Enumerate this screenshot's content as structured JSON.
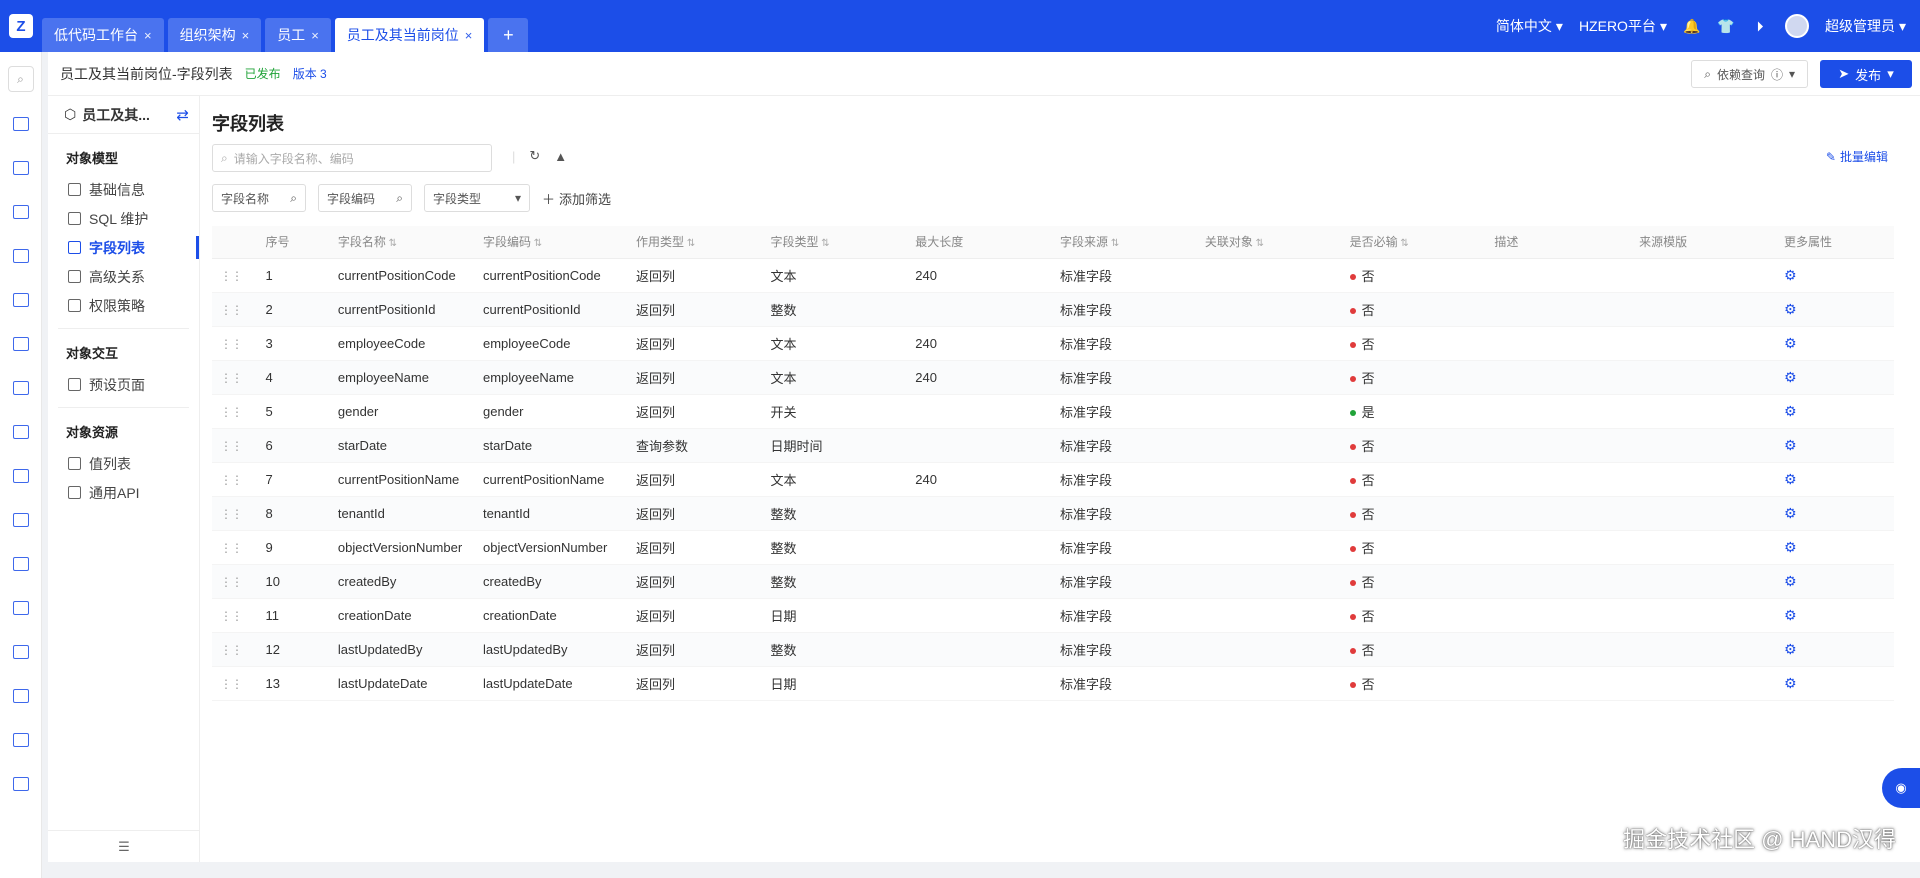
{
  "tabs": [
    {
      "label": "低代码工作台",
      "active": false
    },
    {
      "label": "组织架构",
      "active": false
    },
    {
      "label": "员工",
      "active": false
    },
    {
      "label": "员工及其当前岗位",
      "active": true
    }
  ],
  "topbar": {
    "language": "简体中文",
    "platform": "HZERO平台",
    "user": "超级管理员"
  },
  "header": {
    "title": "员工及其当前岗位-字段列表",
    "status": "已发布",
    "version": "版本 3",
    "dependency_btn": "依赖查询",
    "publish_btn": "发布"
  },
  "nav": {
    "title": "员工及其...",
    "sections": [
      {
        "title": "对象模型",
        "items": [
          "基础信息",
          "SQL 维护",
          "字段列表",
          "高级关系",
          "权限策略"
        ]
      },
      {
        "title": "对象交互",
        "items": [
          "预设页面"
        ]
      },
      {
        "title": "对象资源",
        "items": [
          "值列表",
          "通用API"
        ]
      }
    ]
  },
  "main": {
    "title": "字段列表",
    "search_placeholder": "请输入字段名称、编码",
    "batch_edit": "批量编辑",
    "filters": {
      "name": "字段名称",
      "code": "字段编码",
      "type": "字段类型",
      "add": "添加筛选"
    }
  },
  "table": {
    "headers": [
      "序号",
      "字段名称",
      "字段编码",
      "作用类型",
      "字段类型",
      "最大长度",
      "字段来源",
      "关联对象",
      "是否必输",
      "描述",
      "来源模版",
      "更多属性"
    ],
    "rows": [
      {
        "no": "1",
        "name": "currentPositionCode",
        "code": "currentPositionCode",
        "role": "返回列",
        "type": "文本",
        "maxlen": "240",
        "source": "标准字段",
        "required": "否"
      },
      {
        "no": "2",
        "name": "currentPositionId",
        "code": "currentPositionId",
        "role": "返回列",
        "type": "整数",
        "maxlen": "",
        "source": "标准字段",
        "required": "否"
      },
      {
        "no": "3",
        "name": "employeeCode",
        "code": "employeeCode",
        "role": "返回列",
        "type": "文本",
        "maxlen": "240",
        "source": "标准字段",
        "required": "否"
      },
      {
        "no": "4",
        "name": "employeeName",
        "code": "employeeName",
        "role": "返回列",
        "type": "文本",
        "maxlen": "240",
        "source": "标准字段",
        "required": "否"
      },
      {
        "no": "5",
        "name": "gender",
        "code": "gender",
        "role": "返回列",
        "type": "开关",
        "maxlen": "",
        "source": "标准字段",
        "required": "是"
      },
      {
        "no": "6",
        "name": "starDate",
        "code": "starDate",
        "role": "查询参数",
        "type": "日期时间",
        "maxlen": "",
        "source": "标准字段",
        "required": "否"
      },
      {
        "no": "7",
        "name": "currentPositionName",
        "code": "currentPositionName",
        "role": "返回列",
        "type": "文本",
        "maxlen": "240",
        "source": "标准字段",
        "required": "否"
      },
      {
        "no": "8",
        "name": "tenantId",
        "code": "tenantId",
        "role": "返回列",
        "type": "整数",
        "maxlen": "",
        "source": "标准字段",
        "required": "否"
      },
      {
        "no": "9",
        "name": "objectVersionNumber",
        "code": "objectVersionNumber",
        "role": "返回列",
        "type": "整数",
        "maxlen": "",
        "source": "标准字段",
        "required": "否"
      },
      {
        "no": "10",
        "name": "createdBy",
        "code": "createdBy",
        "role": "返回列",
        "type": "整数",
        "maxlen": "",
        "source": "标准字段",
        "required": "否"
      },
      {
        "no": "11",
        "name": "creationDate",
        "code": "creationDate",
        "role": "返回列",
        "type": "日期",
        "maxlen": "",
        "source": "标准字段",
        "required": "否"
      },
      {
        "no": "12",
        "name": "lastUpdatedBy",
        "code": "lastUpdatedBy",
        "role": "返回列",
        "type": "整数",
        "maxlen": "",
        "source": "标准字段",
        "required": "否"
      },
      {
        "no": "13",
        "name": "lastUpdateDate",
        "code": "lastUpdateDate",
        "role": "返回列",
        "type": "日期",
        "maxlen": "",
        "source": "标准字段",
        "required": "否"
      }
    ]
  },
  "colors": {
    "primary": "#1c4ee8",
    "no": "#e03b3b",
    "yes": "#21a339"
  },
  "watermark": "掘金技术社区 @ HAND汉得"
}
